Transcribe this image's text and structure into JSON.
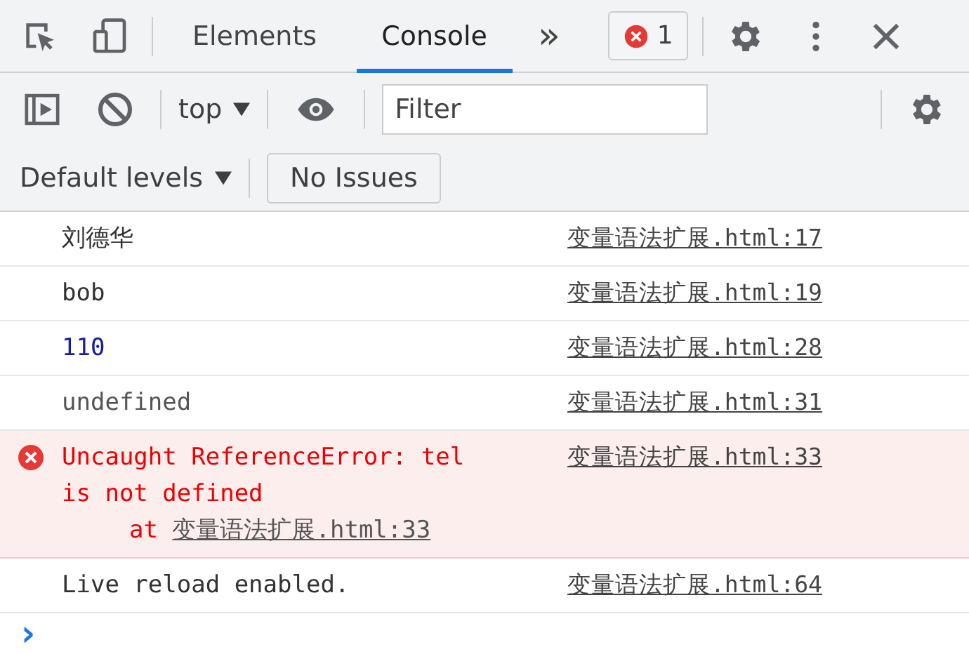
{
  "tabs": [
    {
      "label": "Elements",
      "selected": false
    },
    {
      "label": "Console",
      "selected": true
    }
  ],
  "more_tabs": "»",
  "error_badge": {
    "count": "1"
  },
  "toolbar": {
    "context": "top",
    "filter": {
      "placeholder": "Filter"
    },
    "levels": "Default levels",
    "issues": "No Issues"
  },
  "messages": [
    {
      "kind": "plain",
      "text": "刘德华",
      "source": "变量语法扩展.html:17"
    },
    {
      "kind": "plain",
      "text": "bob",
      "source": "变量语法扩展.html:19"
    },
    {
      "kind": "number",
      "text": "110",
      "source": "变量语法扩展.html:28"
    },
    {
      "kind": "undefined",
      "text": "undefined",
      "source": "变量语法扩展.html:31"
    },
    {
      "kind": "error",
      "text": "Uncaught ReferenceError: tel is not defined",
      "stack_prefix": "at",
      "stack_link": "变量语法扩展.html:33",
      "source": "变量语法扩展.html:33"
    },
    {
      "kind": "plain",
      "text": "Live reload enabled.",
      "source": "变量语法扩展.html:64"
    }
  ],
  "prompt": "›"
}
